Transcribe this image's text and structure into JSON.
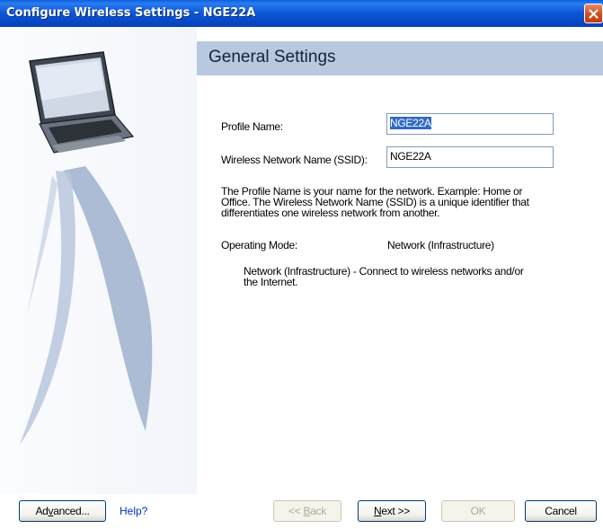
{
  "window": {
    "title": "Configure Wireless Settings - NGE22A"
  },
  "header": {
    "title": "General Settings"
  },
  "form": {
    "profile_name_label": "Profile Name:",
    "profile_name_value": "NGE22A",
    "ssid_label": "Wireless Network Name (SSID):",
    "ssid_value": "NGE22A",
    "description_lines": [
      "The Profile Name is your name for the network. Example: Home or",
      "Office. The Wireless Network Name (SSID) is a unique identifier that",
      "differentiates one wireless network from another."
    ],
    "operating_mode_label": "Operating Mode:",
    "operating_mode_value": "Network (Infrastructure)",
    "mode_description_lines": [
      "Network (Infrastructure) - Connect to wireless networks and/or",
      "the Internet."
    ]
  },
  "buttons": {
    "advanced": {
      "pre": "Ad",
      "mnemonic": "v",
      "post": "anced..."
    },
    "help": "Help?",
    "back": {
      "pre": "<< ",
      "mnemonic": "B",
      "post": "ack"
    },
    "next": {
      "pre": "",
      "mnemonic": "N",
      "post": "ext >>"
    },
    "ok": "OK",
    "cancel": "Cancel"
  },
  "colors": {
    "titlebar": "#0a56d6",
    "header_band": "#b8c8de",
    "link": "#0033cc",
    "selection": "#316ac5"
  },
  "icons": {
    "close": "close-icon",
    "laptop": "laptop-illustration"
  }
}
